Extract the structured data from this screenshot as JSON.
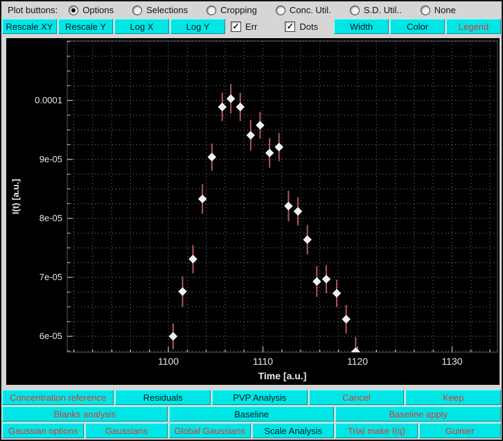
{
  "window": {
    "bg": "#d6d6d6",
    "accent_cyan": "#00e6e6",
    "red_text": "#e03333",
    "plot_bg": "#000000"
  },
  "top_bar": {
    "label": "Plot buttons:",
    "radios": [
      {
        "label": "Options",
        "selected": true
      },
      {
        "label": "Selections",
        "selected": false
      },
      {
        "label": "Cropping",
        "selected": false
      },
      {
        "label": "Conc. Util.",
        "selected": false
      },
      {
        "label": "S.D. Util..",
        "selected": false
      },
      {
        "label": "None",
        "selected": false
      }
    ]
  },
  "toolbar": {
    "left_buttons": [
      {
        "label": "Rescale XY",
        "color": "black"
      },
      {
        "label": "Rescale Y",
        "color": "black"
      },
      {
        "label": "Log X",
        "color": "black"
      },
      {
        "label": "Log Y",
        "color": "black"
      }
    ],
    "checkboxes": [
      {
        "label": "Err",
        "checked": true
      },
      {
        "label": "Dots",
        "checked": true
      }
    ],
    "right_buttons": [
      {
        "label": "Width",
        "color": "black"
      },
      {
        "label": "Color",
        "color": "black"
      },
      {
        "label": "Legend",
        "color": "red"
      }
    ]
  },
  "chart_data": {
    "type": "scatter",
    "title": "",
    "xlabel": "Time [a.u.]",
    "ylabel": "I(t) [a.u.]",
    "xlim": [
      1089.3,
      1134.8
    ],
    "ylim": [
      5.73e-05,
      0.0001101
    ],
    "x_ticks": [
      1100,
      1110,
      1120,
      1130
    ],
    "x_tick_labels": [
      "1100",
      "1110",
      "1120",
      "1130"
    ],
    "y_ticks": [
      6e-05,
      7e-05,
      8e-05,
      9e-05,
      0.0001
    ],
    "y_tick_labels": [
      "6e-05",
      "7e-05",
      "8e-05",
      "9e-05",
      "0.0001"
    ],
    "grid": "dotted",
    "x_grid_step": 2,
    "y_grid_step": 2.5e-06,
    "x_minor_step": 2,
    "y_minor_step": 2.5e-06,
    "x": [
      1100.5,
      1101.5,
      1102.6,
      1103.6,
      1104.6,
      1105.7,
      1106.6,
      1107.6,
      1108.7,
      1109.7,
      1110.7,
      1111.7,
      1112.7,
      1113.7,
      1114.7,
      1115.7,
      1116.7,
      1117.8,
      1118.8,
      1119.8
    ],
    "y": [
      6e-05,
      6.76e-05,
      7.31e-05,
      8.33e-05,
      9.04e-05,
      9.89e-05,
      0.0001003,
      9.89e-05,
      9.41e-05,
      9.58e-05,
      9.11e-05,
      9.21e-05,
      8.21e-05,
      8.12e-05,
      7.64e-05,
      6.93e-05,
      6.97e-05,
      6.73e-05,
      6.29e-05,
      5.74e-05
    ],
    "yerr": [
      2.2e-06,
      2.6e-06,
      2.4e-06,
      2.5e-06,
      2.3e-06,
      2.4e-06,
      2.5e-06,
      2.4e-06,
      2.6e-06,
      2.3e-06,
      2.5e-06,
      2.4e-06,
      2.6e-06,
      2.4e-06,
      2.5e-06,
      2.6e-06,
      2.4e-06,
      2.3e-06,
      2.4e-06,
      2.5e-06
    ],
    "marker": "diamond",
    "marker_color": "#efefef",
    "marker_stroke": "#ffffff",
    "error_color": "#b85454",
    "grid_color": "#9e9e9e",
    "text_color": "#e8e8e8",
    "bg": "#000000",
    "legend_position": "none"
  },
  "bottom": {
    "row1": [
      {
        "label": "Concentration reference",
        "color": "red",
        "w": 1.18
      },
      {
        "label": "Residuals",
        "color": "black",
        "w": 1
      },
      {
        "label": "PVP Analysis",
        "color": "black",
        "w": 1
      },
      {
        "label": "Cancel",
        "color": "red",
        "w": 1
      },
      {
        "label": "Keep",
        "color": "red",
        "w": 1
      }
    ],
    "row2": [
      {
        "label": "Blanks analysis",
        "color": "red",
        "w": 1
      },
      {
        "label": "Baseline",
        "color": "black",
        "w": 1
      },
      {
        "label": "Baseline apply",
        "color": "red",
        "w": 1
      }
    ],
    "row3": [
      {
        "label": "Gaussian options",
        "color": "red",
        "w": 1
      },
      {
        "label": "Gaussians",
        "color": "red",
        "w": 1
      },
      {
        "label": "Global Gaussians",
        "color": "red",
        "w": 1
      },
      {
        "label": "Scale Analysis",
        "color": "black",
        "w": 1
      },
      {
        "label": "Trial make I(q)",
        "color": "red",
        "w": 1
      },
      {
        "label": "Guinier",
        "color": "red",
        "w": 1
      }
    ]
  }
}
